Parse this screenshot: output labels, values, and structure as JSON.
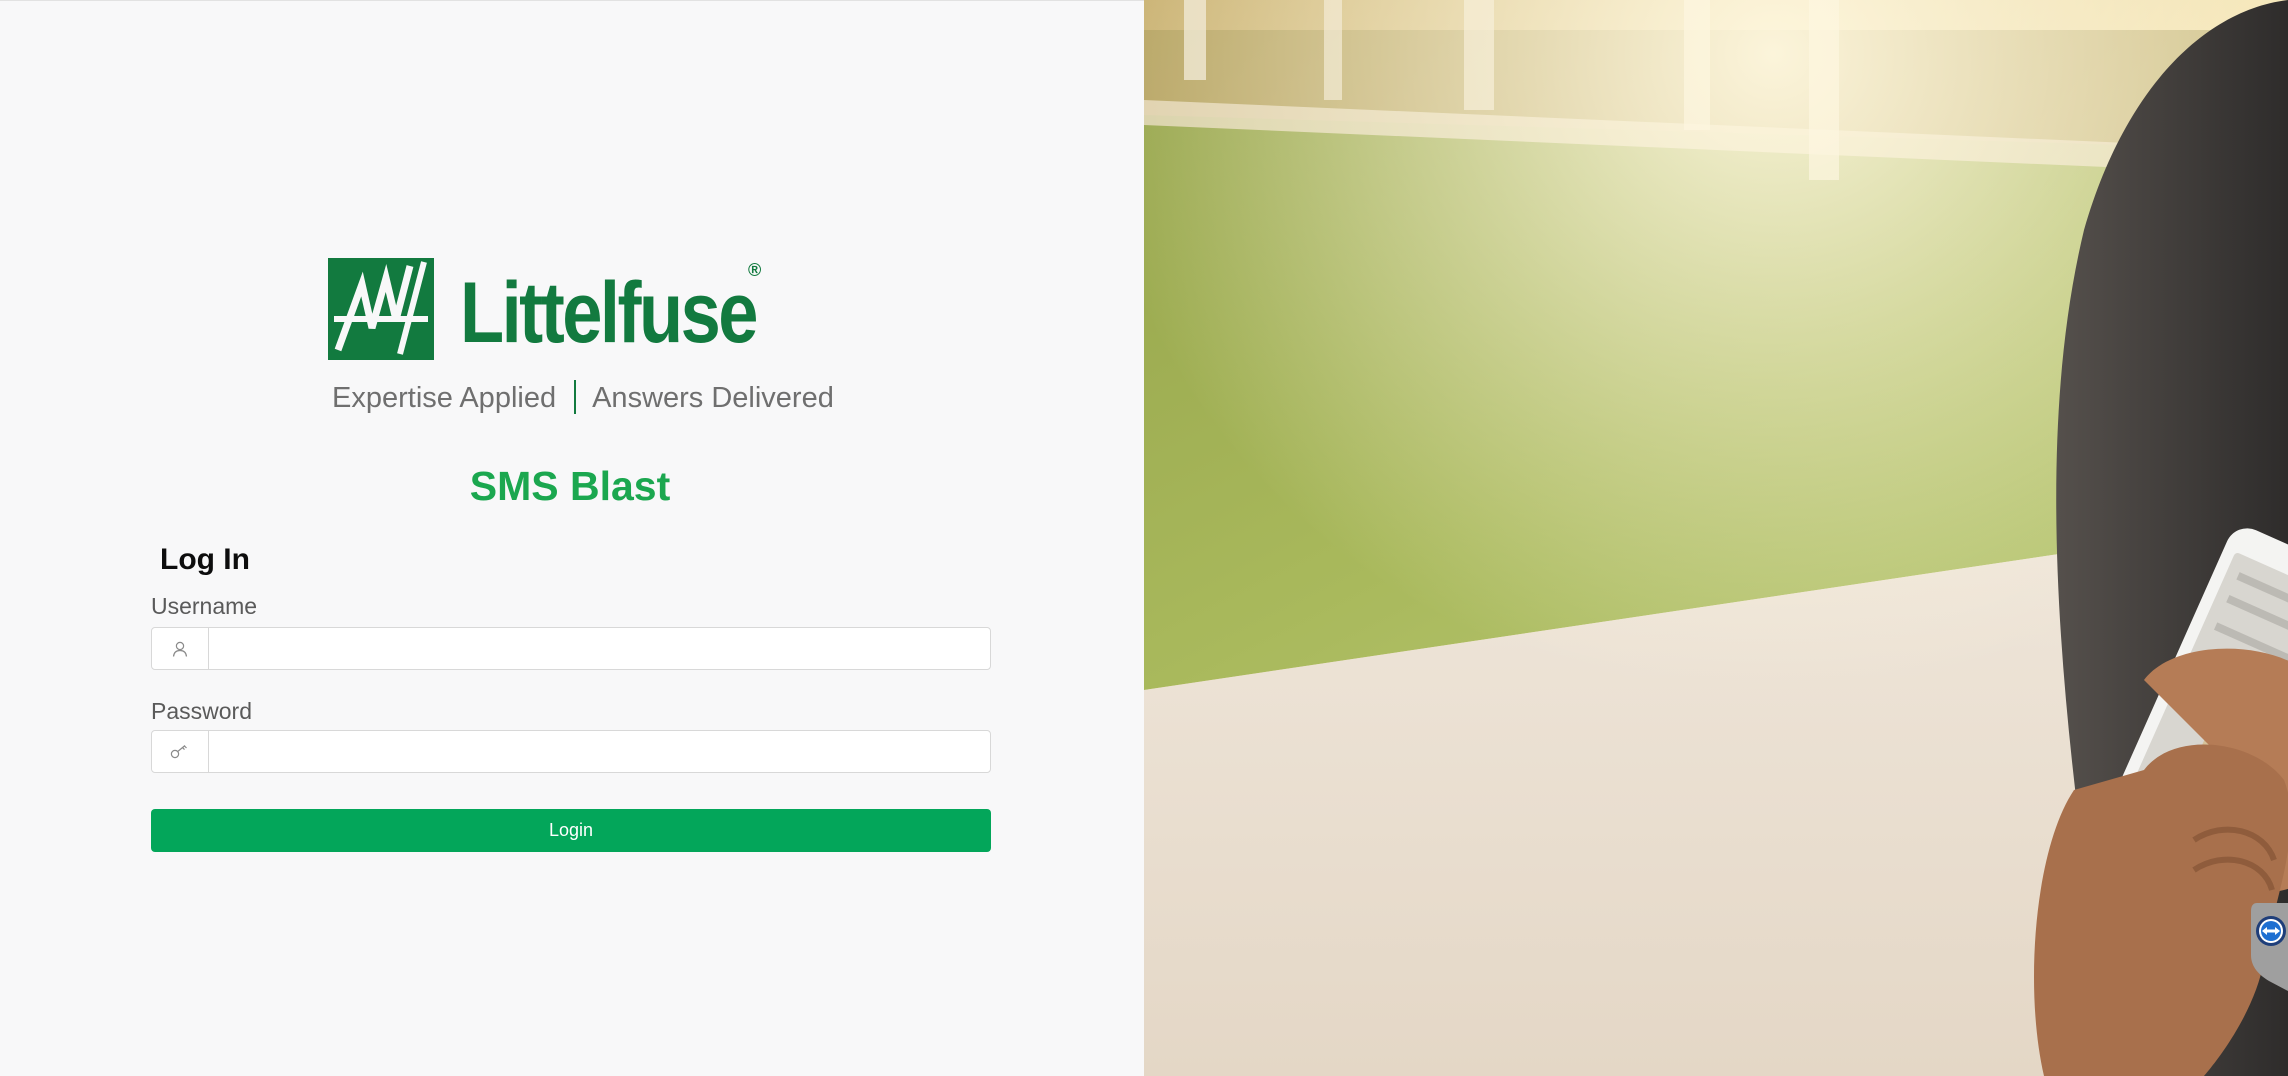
{
  "brand": {
    "logo_text": "Littelfuse",
    "registered_mark": "®",
    "tagline_left": "Expertise Applied",
    "tagline_right": "Answers Delivered",
    "color_primary": "#127a3f",
    "color_accent": "#1ba74f"
  },
  "app": {
    "title": "SMS Blast"
  },
  "login_form": {
    "heading": "Log In",
    "username_label": "Username",
    "username_value": "",
    "username_icon": "user-icon",
    "password_label": "Password",
    "password_value": "",
    "password_icon": "key-icon",
    "submit_label": "Login",
    "submit_color": "#03a65a"
  },
  "hero_image": {
    "description_icon": "person-holding-phone-photo"
  },
  "side_widget": {
    "icon": "remote-support-icon"
  }
}
